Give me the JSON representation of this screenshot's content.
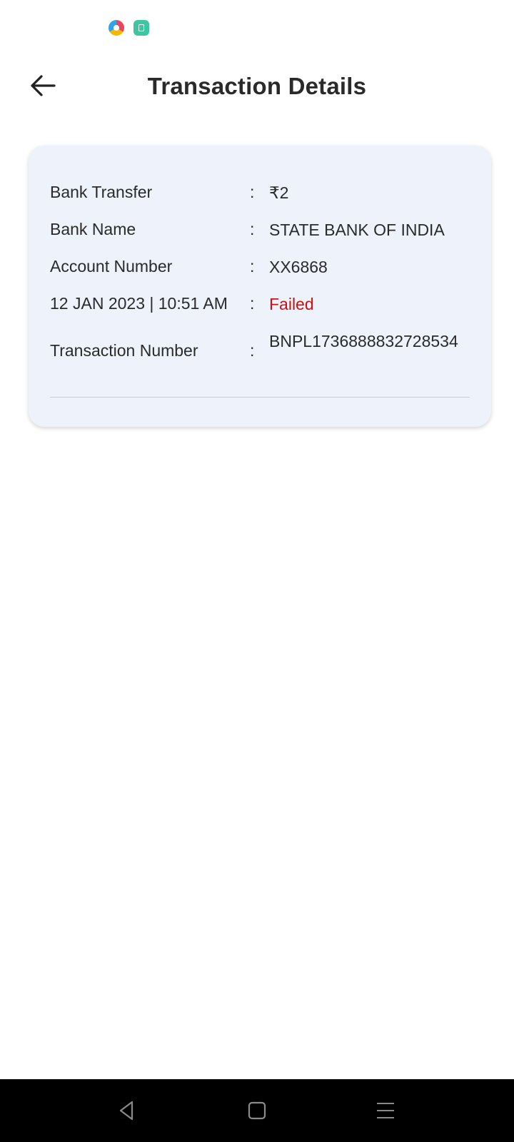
{
  "header": {
    "title": "Transaction Details"
  },
  "details": {
    "bank_transfer": {
      "label": "Bank Transfer",
      "separator": ":",
      "value": "₹2"
    },
    "bank_name": {
      "label": "Bank Name",
      "separator": ":",
      "value": "STATE BANK OF INDIA"
    },
    "account_number": {
      "label": "Account Number",
      "separator": ":",
      "value": "XX6868"
    },
    "date_status": {
      "label": "12 JAN 2023 | 10:51 AM",
      "separator": ":",
      "value": "Failed"
    },
    "transaction_number": {
      "label": "Transaction Number",
      "separator": ":",
      "value": "BNPL1736888832728534"
    }
  },
  "colors": {
    "card_background": "#eef2fb",
    "status_failed": "#cc1111",
    "nav_bar": "#000000"
  },
  "icons": {
    "back": "arrow-left-icon",
    "nav_back": "triangle-back-icon",
    "nav_home": "square-home-icon",
    "nav_menu": "three-lines-menu-icon"
  }
}
